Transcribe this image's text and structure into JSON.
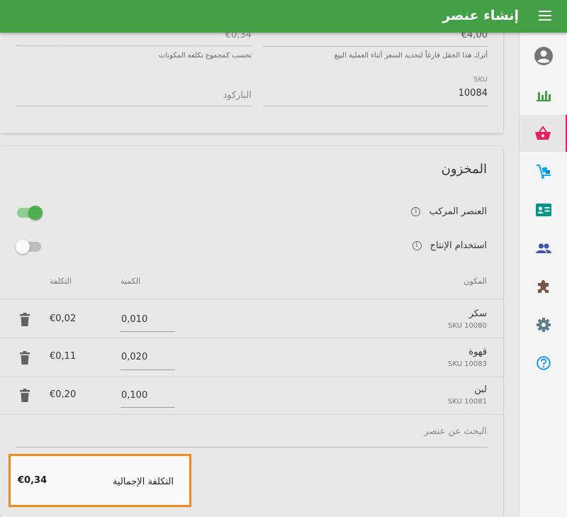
{
  "appbar": {
    "title": "إنشاء عنصر"
  },
  "details": {
    "price_value": "€4,00",
    "price_hint": "أترك هذا الحقل فارغاً لتحديد السعر أثناء العملية البيع",
    "cost_value": "€0,34",
    "cost_hint": "تحسب كمجموع تكلفة المكونات",
    "sku_label": "SKU",
    "sku_value": "10084",
    "barcode_placeholder": "الباركود"
  },
  "inventory": {
    "title": "المخزون",
    "composite_label": "العنصر المركب",
    "composite_on": true,
    "production_label": "استخدام الإنتاج",
    "production_on": false,
    "headers": {
      "component": "المكون",
      "quantity": "الكمية",
      "cost": "التكلفة"
    },
    "rows": [
      {
        "name": "سكر",
        "sku": "SKU 10080",
        "quantity": "0,010",
        "cost": "€0,02"
      },
      {
        "name": "قهوة",
        "sku": "SKU 10083",
        "quantity": "0,020",
        "cost": "€0,11"
      },
      {
        "name": "لبن",
        "sku": "SKU 10081",
        "quantity": "0,100",
        "cost": "€0,20"
      }
    ],
    "search_placeholder": "البحث عن عنصر",
    "total_label": "التكلفة الإجمالية",
    "total_value": "€0,34"
  },
  "sidebar": {
    "items": [
      {
        "icon": "account-icon",
        "color": "#757575"
      },
      {
        "icon": "reports-icon",
        "color": "#43a047"
      },
      {
        "icon": "items-basket-icon",
        "color": "#e91e63",
        "active": true
      },
      {
        "icon": "inventory-icon",
        "color": "#03a9f4"
      },
      {
        "icon": "employees-icon",
        "color": "#009688"
      },
      {
        "icon": "customers-icon",
        "color": "#3f51b5"
      },
      {
        "icon": "integrations-icon",
        "color": "#795548"
      },
      {
        "icon": "settings-icon",
        "color": "#607d8b"
      },
      {
        "icon": "help-icon",
        "color": "#2196f3"
      }
    ]
  }
}
